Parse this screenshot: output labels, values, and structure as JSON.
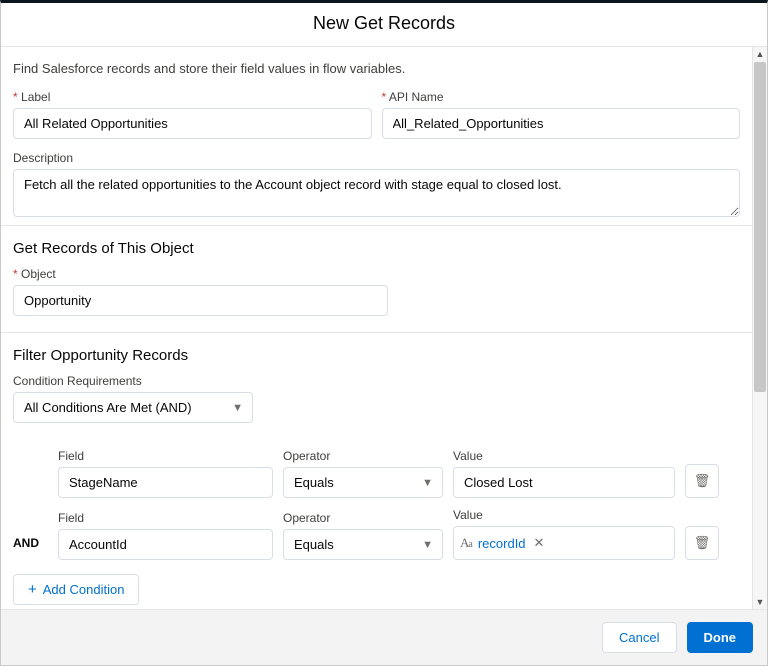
{
  "header": {
    "title": "New Get Records"
  },
  "intro": {
    "text": "Find Salesforce records and store their field values in flow variables."
  },
  "fields": {
    "label_label": "Label",
    "label_value": "All Related Opportunities",
    "api_label": "API Name",
    "api_value": "All_Related_Opportunities",
    "desc_label": "Description",
    "desc_value": "Fetch all the related opportunities to the Account object record with stage equal to closed lost."
  },
  "object_section": {
    "title": "Get Records of This Object",
    "object_label": "Object",
    "object_value": "Opportunity"
  },
  "filter_section": {
    "title": "Filter Opportunity Records",
    "req_label": "Condition Requirements",
    "req_value": "All Conditions Are Met (AND)",
    "field_header": "Field",
    "op_header": "Operator",
    "val_header": "Value",
    "rows": [
      {
        "prefix": "",
        "field": "StageName",
        "operator": "Equals",
        "value_type": "text",
        "value": "Closed Lost"
      },
      {
        "prefix": "AND",
        "field": "AccountId",
        "operator": "Equals",
        "value_type": "pill",
        "value": "recordId"
      }
    ],
    "add_label": "Add Condition"
  },
  "footer": {
    "cancel": "Cancel",
    "done": "Done"
  }
}
